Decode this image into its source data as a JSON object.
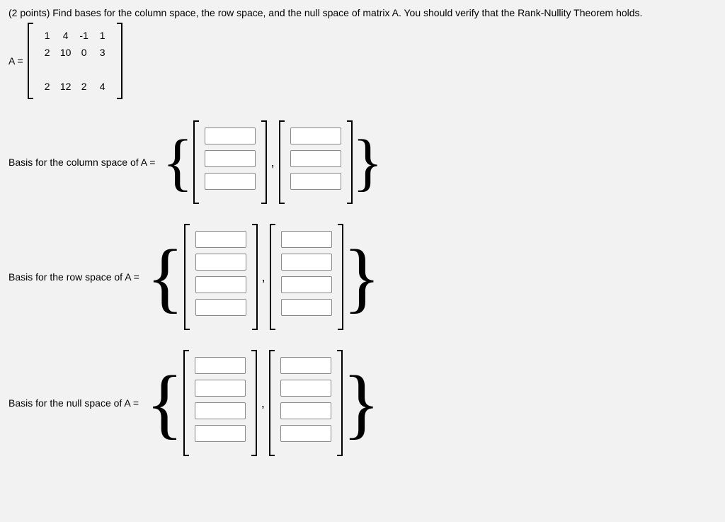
{
  "question": {
    "points": "(2 points)",
    "text": "Find bases for the column space, the row space, and the null space of matrix A. You should verify that the Rank-Nullity Theorem holds."
  },
  "matrix": {
    "label": "A =",
    "rows": [
      [
        "1",
        "4",
        "-1",
        "1"
      ],
      [
        "2",
        "10",
        "0",
        "3"
      ],
      [
        "",
        "",
        "",
        ""
      ],
      [
        "2",
        "12",
        "2",
        "4"
      ]
    ]
  },
  "sections": {
    "col": {
      "label": "Basis for the column space of A =",
      "rows": 3,
      "vectors": 2
    },
    "row": {
      "label": "Basis for the row space of A =",
      "rows": 4,
      "vectors": 2
    },
    "null": {
      "label": "Basis for the null space of A =",
      "rows": 4,
      "vectors": 2
    }
  }
}
